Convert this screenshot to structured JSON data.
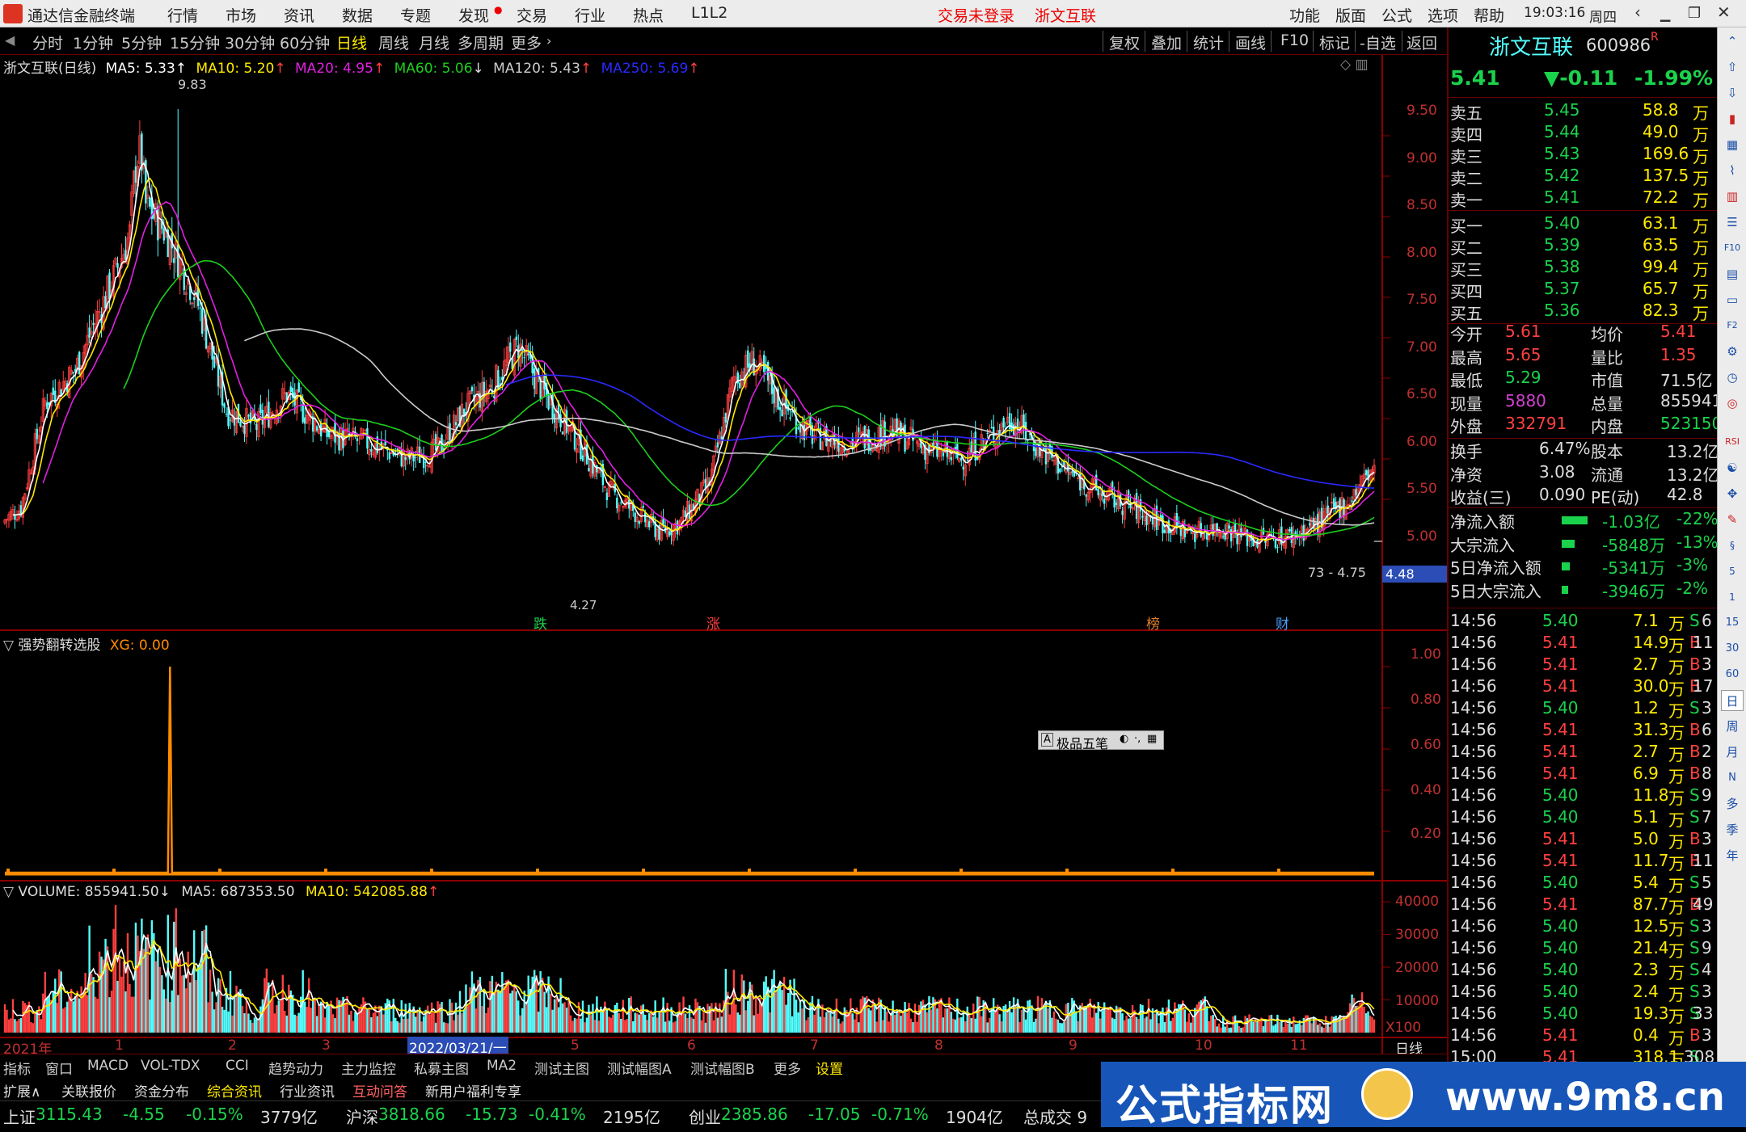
{
  "app": {
    "title": "通达信金融终端",
    "menu": [
      "行情",
      "市场",
      "资讯",
      "数据",
      "专题",
      "发现",
      "交易",
      "行业",
      "热点",
      "L1L2"
    ],
    "login_status": "交易未登录",
    "stock_tab": "浙文互联",
    "right_menu": [
      "功能",
      "版面",
      "公式",
      "选项",
      "帮助"
    ],
    "time": "19:03:16",
    "weekday": "周四"
  },
  "periods": [
    "分时",
    "1分钟",
    "5分钟",
    "15分钟",
    "30分钟",
    "60分钟",
    "日线",
    "周线",
    "月线",
    "多周期",
    "更多"
  ],
  "active_period": "日线",
  "toolbar": [
    "复权",
    "叠加",
    "统计",
    "画线",
    "F10",
    "标记",
    "-自选",
    "返回"
  ],
  "main_legend": {
    "name": "浙文互联(日线)",
    "ma5": "MA5: 5.33",
    "ma10": "MA10: 5.20",
    "ma20": "MA20: 4.95",
    "ma60": "MA60: 5.06",
    "ma120": "MA120: 5.43",
    "ma250": "MA250: 5.69"
  },
  "price_axis": [
    "9.50",
    "9.00",
    "8.50",
    "8.00",
    "7.50",
    "7.00",
    "6.50",
    "6.00",
    "5.50",
    "5.00"
  ],
  "price_tag": "4.48",
  "high_label": "9.83",
  "low_label": "4.27",
  "range_label": "73 - 4.75",
  "event_tags": [
    {
      "t": "跌",
      "c": "#1bd24c"
    },
    {
      "t": "涨",
      "c": "#ff4040"
    },
    {
      "t": "榜",
      "c": "#e08030"
    },
    {
      "t": "财",
      "c": "#4aa0ff"
    }
  ],
  "ind_legend": {
    "name": "强势翻转选股",
    "val": "XG: 0.00"
  },
  "ind_axis": [
    "1.00",
    "0.80",
    "0.60",
    "0.40",
    "0.20"
  ],
  "vol_legend": {
    "name": "VOLUME: 855941.50",
    "ma5": "MA5: 687353.50",
    "ma10": "MA10: 542085.88"
  },
  "vol_axis": [
    "40000",
    "30000",
    "20000",
    "10000"
  ],
  "vol_unit": "X100",
  "date_axis": {
    "start": "2021年",
    "months": [
      "1",
      "2",
      "3",
      "5",
      "6",
      "7",
      "8",
      "9",
      "10",
      "11"
    ],
    "cursor": "2022/03/21/一",
    "label": "日线"
  },
  "popup": {
    "label": "极品五笔"
  },
  "quote": {
    "name": "浙文互联",
    "code": "600986",
    "flag": "R",
    "price": "5.41",
    "change": "▼-0.11",
    "pct": "-1.99%"
  },
  "asks": [
    {
      "l": "卖五",
      "p": "5.45",
      "v": "58.8",
      "u": "万"
    },
    {
      "l": "卖四",
      "p": "5.44",
      "v": "49.0",
      "u": "万"
    },
    {
      "l": "卖三",
      "p": "5.43",
      "v": "169.6",
      "u": "万"
    },
    {
      "l": "卖二",
      "p": "5.42",
      "v": "137.5",
      "u": "万"
    },
    {
      "l": "卖一",
      "p": "5.41",
      "v": "72.2",
      "u": "万"
    }
  ],
  "bids": [
    {
      "l": "买一",
      "p": "5.40",
      "v": "63.1",
      "u": "万"
    },
    {
      "l": "买二",
      "p": "5.39",
      "v": "63.5",
      "u": "万"
    },
    {
      "l": "买三",
      "p": "5.38",
      "v": "99.4",
      "u": "万"
    },
    {
      "l": "买四",
      "p": "5.37",
      "v": "65.7",
      "u": "万"
    },
    {
      "l": "买五",
      "p": "5.36",
      "v": "82.3",
      "u": "万"
    }
  ],
  "stats": [
    {
      "l": "今开",
      "v": "5.61",
      "vc": "#ff4040",
      "l2": "均价",
      "v2": "5.41",
      "v2c": "#ff4040"
    },
    {
      "l": "最高",
      "v": "5.65",
      "vc": "#ff4040",
      "l2": "量比",
      "v2": "1.35",
      "v2c": "#ff4040"
    },
    {
      "l": "最低",
      "v": "5.29",
      "vc": "#1bd24c",
      "l2": "市值",
      "v2": "71.5亿",
      "v2c": "#ddd"
    },
    {
      "l": "现量",
      "v": "5880",
      "vc": "#d040d0",
      "l2": "总量",
      "v2": "855941",
      "v2c": "#ddd"
    },
    {
      "l": "外盘",
      "v": "332791",
      "vc": "#ff4040",
      "l2": "内盘",
      "v2": "523150",
      "v2c": "#1bd24c"
    }
  ],
  "fund": [
    {
      "l": "换手",
      "v": "6.47%",
      "l2": "股本",
      "v2": "13.2亿"
    },
    {
      "l": "净资",
      "v": "3.08",
      "l2": "流通",
      "v2": "13.2亿"
    },
    {
      "l": "收益(三)",
      "v": "0.090",
      "l2": "PE(动)",
      "v2": "42.8"
    }
  ],
  "flow": [
    {
      "l": "净流入额",
      "v": "-1.03亿",
      "p": "-22%",
      "bar": 0.8
    },
    {
      "l": "大宗流入",
      "v": "-5848万",
      "p": "-13%",
      "bar": 0.4
    },
    {
      "l": "5日净流入额",
      "v": "-5341万",
      "p": "-3%",
      "bar": 0.25
    },
    {
      "l": "5日大宗流入",
      "v": "-3946万",
      "p": "-2%",
      "bar": 0.2
    }
  ],
  "ticks": [
    [
      "14:56",
      "5.40",
      "7.1",
      "S",
      "6"
    ],
    [
      "14:56",
      "5.41",
      "14.9",
      "B",
      "11"
    ],
    [
      "14:56",
      "5.41",
      "2.7",
      "B",
      "3"
    ],
    [
      "14:56",
      "5.41",
      "30.0",
      "B",
      "17"
    ],
    [
      "14:56",
      "5.40",
      "1.2",
      "S",
      "3"
    ],
    [
      "14:56",
      "5.41",
      "31.3",
      "B",
      "6"
    ],
    [
      "14:56",
      "5.41",
      "2.7",
      "B",
      "2"
    ],
    [
      "14:56",
      "5.41",
      "6.9",
      "B",
      "8"
    ],
    [
      "14:56",
      "5.40",
      "11.8",
      "S",
      "9"
    ],
    [
      "14:56",
      "5.40",
      "5.1",
      "S",
      "7"
    ],
    [
      "14:56",
      "5.41",
      "5.0",
      "B",
      "3"
    ],
    [
      "14:56",
      "5.41",
      "11.7",
      "B",
      "11"
    ],
    [
      "14:56",
      "5.40",
      "5.4",
      "S",
      "5"
    ],
    [
      "14:56",
      "5.41",
      "87.7",
      "B",
      "49"
    ],
    [
      "14:56",
      "5.40",
      "12.5",
      "S",
      "3"
    ],
    [
      "14:56",
      "5.40",
      "21.4",
      "S",
      "9"
    ],
    [
      "14:56",
      "5.40",
      "2.3",
      "S",
      "4"
    ],
    [
      "14:56",
      "5.40",
      "2.4",
      "S",
      "3"
    ],
    [
      "14:56",
      "5.40",
      "19.3",
      "S",
      "33"
    ],
    [
      "14:56",
      "5.41",
      "0.4",
      "B",
      "3"
    ],
    [
      "15:00",
      "5.41",
      "318.1",
      "S",
      "308"
    ]
  ],
  "tick_unit": "万",
  "side_tools": [
    "周",
    "月",
    "季",
    "年"
  ],
  "side_tools2": [
    "15",
    "30",
    "60",
    "日",
    "N",
    "多"
  ],
  "bottom_tabs": [
    "指标",
    "窗口",
    "MACD",
    "VOL-TDX",
    "CCI",
    "趋势动力",
    "主力监控",
    "私募主图",
    "MA2",
    "测试主图",
    "测试幅图A",
    "测试幅图B",
    "更多",
    "设置"
  ],
  "info_tabs": [
    "扩展∧",
    "关联报价",
    "资金分布",
    "综合资讯",
    "行业资讯",
    "互动问答",
    "新用户福利专享"
  ],
  "ticker": [
    {
      "n": "上证",
      "v": "3115.43",
      "c": "-4.55",
      "p": "-0.15%",
      "a": "3779亿"
    },
    {
      "n": "沪深",
      "v": "3818.66",
      "c": "-15.73",
      "p": "-0.41%",
      "a": "2195亿"
    },
    {
      "n": "创业",
      "v": "2385.86",
      "c": "-17.05",
      "p": "-0.71%",
      "a": "1904亿"
    }
  ],
  "ticker_tail": "总成交 9",
  "banner": {
    "left": "公式指标网",
    "right": "www.9m8.cn"
  },
  "colors": {
    "up": "#ff4040",
    "down": "#1bd24c",
    "cyan": "#54ffff",
    "ma5": "#ffffff",
    "ma10": "#ffea00",
    "ma20": "#e020e0",
    "ma60": "#1ccf1c",
    "ma120": "#cccccc",
    "ma250": "#2a2aff",
    "frame": "#8a0000",
    "blue_tag": "#2b4db5"
  }
}
